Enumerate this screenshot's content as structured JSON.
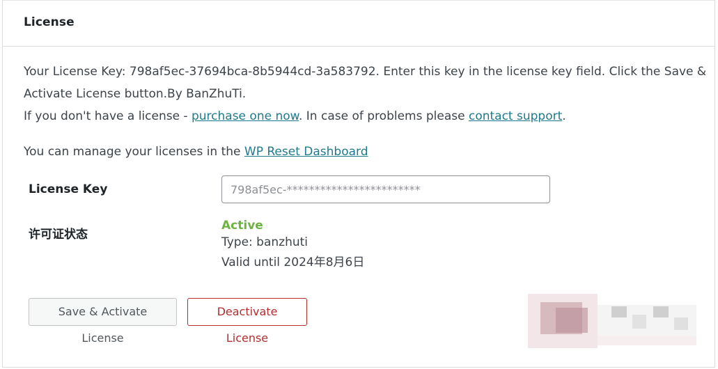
{
  "panel": {
    "title": "License"
  },
  "content": {
    "license_info_line1": "Your License Key: 798af5ec-37694bca-8b5944cd-3a583792. Enter this key in the license key field. Click the Save &",
    "license_info_line2": "Activate License button.By BanZhuTi.",
    "no_license_prefix": "If you don't have a license - ",
    "purchase_link": "purchase one now",
    "problems_text": ". In case of problems please ",
    "support_link": "contact support",
    "period": ".",
    "manage_prefix": "You can manage your licenses in the ",
    "dashboard_link": "WP Reset Dashboard"
  },
  "form": {
    "license_key_label": "License Key",
    "license_key_value": "798af5ec-************************",
    "status_label": "许可证状态",
    "status_value": "Active",
    "status_type": "Type: banzhuti",
    "status_valid": "Valid until 2024年8月6日"
  },
  "buttons": {
    "save_activate": "Save & Activate License",
    "deactivate": "Deactivate License"
  },
  "colors": {
    "link": "#1f7a8c",
    "active_status": "#6cb33f",
    "deactivate": "#b32d2e"
  }
}
